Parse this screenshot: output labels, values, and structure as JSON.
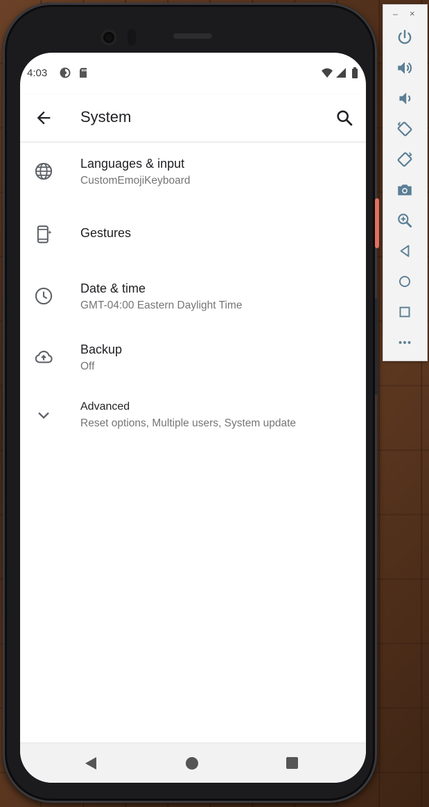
{
  "status_bar": {
    "time": "4:03"
  },
  "app_bar": {
    "title": "System"
  },
  "settings_items": [
    {
      "label": "Languages & input",
      "summary": "CustomEmojiKeyboard",
      "icon": "globe-icon"
    },
    {
      "label": "Gestures",
      "summary": "",
      "icon": "gestures-phone-icon"
    },
    {
      "label": "Date & time",
      "summary": "GMT-04:00 Eastern Daylight Time",
      "icon": "clock-icon"
    },
    {
      "label": "Backup",
      "summary": "Off",
      "icon": "cloud-upload-icon"
    },
    {
      "label": "Advanced",
      "summary": "Reset options, Multiple users, System update",
      "icon": "chevron-down-icon"
    }
  ],
  "emulator_toolbar": {
    "minimize": "–",
    "close": "×",
    "buttons": [
      "power-icon",
      "volume-up-icon",
      "volume-down-icon",
      "rotate-left-icon",
      "rotate-right-icon",
      "camera-icon",
      "zoom-icon",
      "back-icon",
      "home-icon",
      "overview-icon",
      "more-icon"
    ]
  },
  "colors": {
    "accent_icon": "#5f6368",
    "toolbar_icon": "#5b7f95",
    "text_primary": "#202124",
    "text_secondary": "#757575"
  }
}
